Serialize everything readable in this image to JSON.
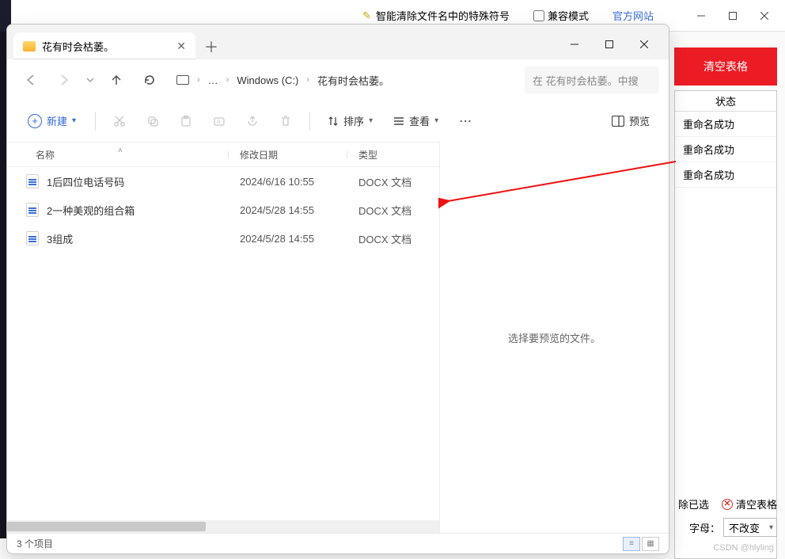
{
  "bg": {
    "title": "智能清除文件名中的特殊符号",
    "compat_label": "兼容模式",
    "site_link": "官方网站",
    "clear_btn": "清空表格",
    "status_header": "状态",
    "status_rows": [
      "重命名成功",
      "重命名成功",
      "重命名成功"
    ],
    "remove_selected": "除已选",
    "clear_table2": "清空表格",
    "font_label": "字母：",
    "font_value": "不改变",
    "watermark": "CSDN @hlyling"
  },
  "explorer": {
    "tab_title": "花有时会枯萎。",
    "breadcrumb": {
      "ellipsis": "…",
      "drive": "Windows (C:)",
      "folder": "花有时会枯萎。"
    },
    "search_placeholder": "在 花有时会枯萎。中搜",
    "toolbar": {
      "new": "新建",
      "sort": "排序",
      "view": "查看",
      "preview": "预览"
    },
    "columns": {
      "name": "名称",
      "date": "修改日期",
      "type": "类型"
    },
    "rows": [
      {
        "name": "1后四位电话号码",
        "date": "2024/6/16 10:55",
        "type": "DOCX 文档"
      },
      {
        "name": "2一种美观的组合箱",
        "date": "2024/5/28 14:55",
        "type": "DOCX 文档"
      },
      {
        "name": "3组成",
        "date": "2024/5/28 14:55",
        "type": "DOCX 文档"
      }
    ],
    "preview_hint": "选择要预览的文件。",
    "status": "3 个项目"
  }
}
